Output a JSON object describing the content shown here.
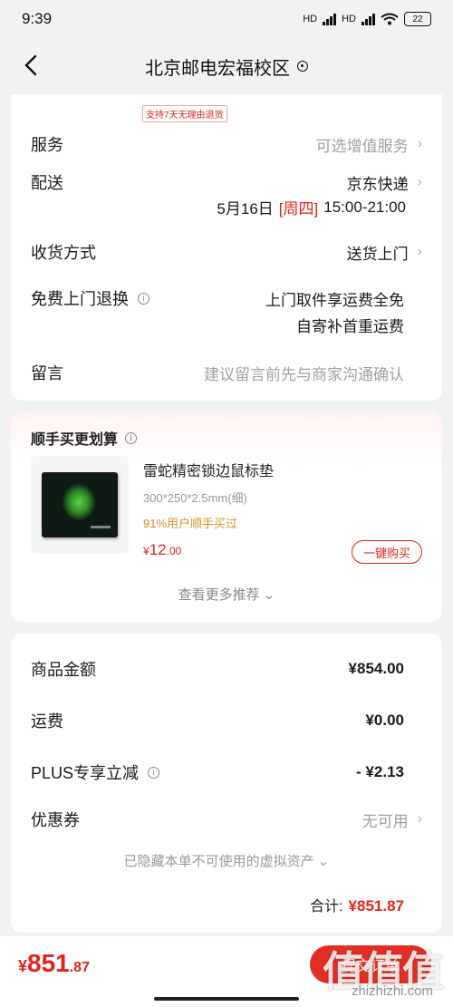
{
  "status": {
    "time": "9:39",
    "hd1": "HD",
    "hd2": "HD",
    "battery": "22"
  },
  "nav": {
    "title": "北京邮电宏福校区"
  },
  "order": {
    "return_badge": "支持7天无理由退货",
    "service": {
      "label": "服务",
      "value": "可选增值服务"
    },
    "delivery": {
      "label": "配送",
      "carrier": "京东快递",
      "date": "5月16日",
      "weekday": "[周四]",
      "time": "15:00-21:00"
    },
    "receive": {
      "label": "收货方式",
      "value": "送货上门"
    },
    "free_return": {
      "label": "免费上门退换",
      "line1": "上门取件享运费全免",
      "line2": "自寄补首重运费"
    },
    "message": {
      "label": "留言",
      "placeholder": "建议留言前先与商家沟通确认"
    }
  },
  "upsell": {
    "title": "顺手买更划算",
    "product": {
      "name": "雷蛇精密锁边鼠标垫",
      "spec": "300*250*2.5mm(细)",
      "tag": "91%用户顺手买过",
      "currency": "¥",
      "price_int": "12",
      "price_dec": ".00",
      "buy_label": "一键购买"
    },
    "more_label": "查看更多推荐"
  },
  "summary": {
    "goods": {
      "label": "商品金额",
      "value": "¥854.00"
    },
    "shipping": {
      "label": "运费",
      "value": "¥0.00"
    },
    "plus": {
      "label": "PLUS专享立减",
      "value": "- ¥2.13"
    },
    "coupon": {
      "label": "优惠券",
      "value": "无可用"
    },
    "hidden_assets": "已隐藏本单不可使用的虚拟资产",
    "total_label": "合计:",
    "total_value": "¥851.87"
  },
  "bottom": {
    "currency": "¥",
    "price_int": "851",
    "price_dec": ".87",
    "submit_label": "提交订单",
    "watermark": "值值值",
    "watermark_sub": "zhizhizhi.com"
  },
  "colors": {
    "accent": "#e2231a",
    "muted": "#a0a0a0",
    "tag": "#d9911f"
  },
  "icons": [
    "back-icon",
    "location-pin-icon",
    "chevron-right-icon",
    "info-icon",
    "chevron-down-icon",
    "signal-icon",
    "wifi-icon",
    "battery-icon"
  ]
}
